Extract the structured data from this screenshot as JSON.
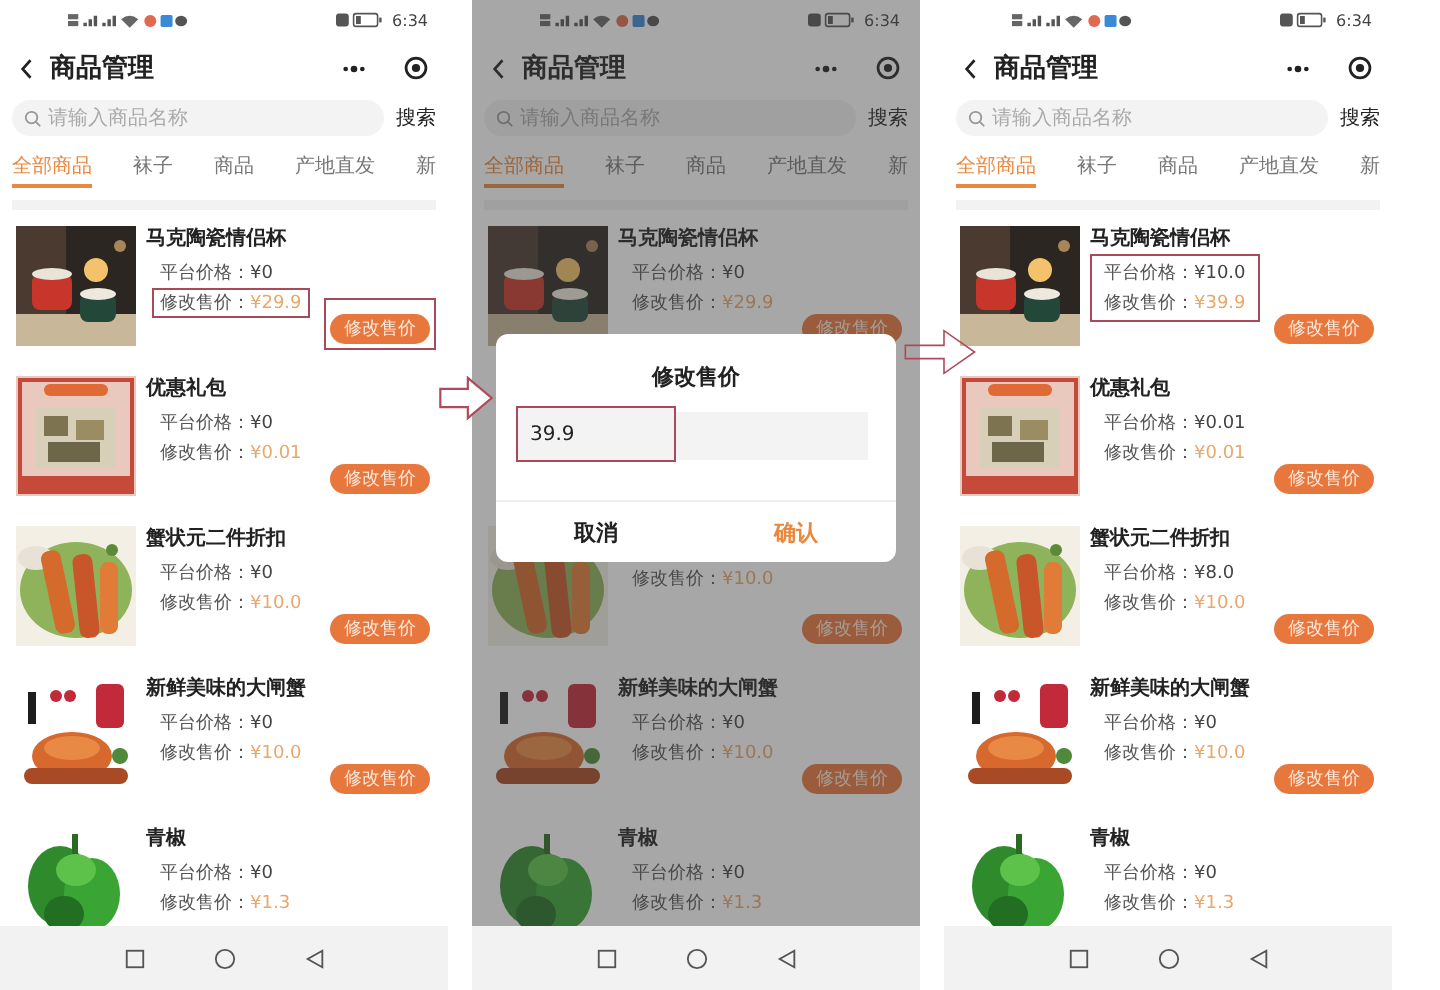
{
  "phones": [
    {
      "status_time": "6:34",
      "title": "商品管理",
      "search_placeholder": "请输入商品名称",
      "search_button": "搜索",
      "dimmed": false,
      "tabs": [
        {
          "label": "全部商品",
          "selected": true
        },
        {
          "label": "袜子",
          "selected": false
        },
        {
          "label": "商品",
          "selected": false
        },
        {
          "label": "产地直发",
          "selected": false
        },
        {
          "label": "新",
          "selected": false
        }
      ],
      "list": [
        {
          "kind": "product",
          "name": "马克陶瓷情侣杯",
          "platform_label": "平台价格：",
          "platform_price": "¥0",
          "modified_label": "修改售价：",
          "modified_price": "¥29.9",
          "modified_price_highlighted": true,
          "prices_highlighted": false,
          "button": "修改售价",
          "button_highlighted": true
        },
        {
          "kind": "product",
          "name": "优惠礼包",
          "platform_label": "平台价格：",
          "platform_price": "¥0",
          "modified_label": "修改售价：",
          "modified_price": "¥0.01",
          "modified_price_highlighted": false,
          "prices_highlighted": false,
          "button": "修改售价",
          "button_highlighted": false
        },
        {
          "kind": "product",
          "name": "蟹状元二件折扣",
          "platform_label": "平台价格：",
          "platform_price": "¥0",
          "modified_label": "修改售价：",
          "modified_price": "¥10.0",
          "modified_price_highlighted": false,
          "prices_highlighted": false,
          "button": "修改售价",
          "button_highlighted": false
        },
        {
          "kind": "product",
          "name": "新鲜美味的大闸蟹",
          "platform_label": "平台价格：",
          "platform_price": "¥0",
          "modified_label": "修改售价：",
          "modified_price": "¥10.0",
          "modified_price_highlighted": false,
          "prices_highlighted": false,
          "button": "修改售价",
          "button_highlighted": false
        },
        {
          "kind": "product",
          "name": "青椒",
          "platform_label": "平台价格：",
          "platform_price": "¥0",
          "modified_label": "修改售价：",
          "modified_price": "¥1.3",
          "modified_price_highlighted": false,
          "prices_highlighted": false
        }
      ]
    },
    {
      "status_time": "6:34",
      "title": "商品管理",
      "search_placeholder": "请输入商品名称",
      "search_button": "搜索",
      "dimmed": true,
      "tabs": [
        {
          "label": "全部商品",
          "selected": true
        },
        {
          "label": "袜子",
          "selected": false
        },
        {
          "label": "商品",
          "selected": false
        },
        {
          "label": "产地直发",
          "selected": false
        },
        {
          "label": "新",
          "selected": false
        }
      ],
      "list": [
        {
          "kind": "product",
          "name": "马克陶瓷情侣杯",
          "platform_label": "平台价格：",
          "platform_price": "¥0",
          "modified_label": "修改售价：",
          "modified_price": "¥29.9",
          "modified_price_highlighted": false,
          "prices_highlighted": false,
          "button": "修改售价",
          "button_highlighted": false
        },
        {
          "kind": "dialog",
          "title": "修改售价",
          "value": "39.9",
          "field_highlighted": true,
          "cancel": "取消",
          "confirm": "确认"
        },
        {
          "kind": "product",
          "modified_label": "修改售价：",
          "modified_price": "¥10.0",
          "modified_price_highlighted": false,
          "prices_highlighted": false,
          "button": "修改售价",
          "button_highlighted": false
        },
        {
          "kind": "product",
          "name": "新鲜美味的大闸蟹",
          "platform_label": "平台价格：",
          "platform_price": "¥0",
          "modified_label": "修改售价：",
          "modified_price": "¥10.0",
          "modified_price_highlighted": false,
          "prices_highlighted": false,
          "button": "修改售价",
          "button_highlighted": false
        },
        {
          "kind": "product",
          "name": "青椒",
          "platform_label": "平台价格：",
          "platform_price": "¥0",
          "modified_label": "修改售价：",
          "modified_price": "¥1.3",
          "modified_price_highlighted": false,
          "prices_highlighted": false
        }
      ]
    },
    {
      "status_time": "6:34",
      "title": "商品管理",
      "search_placeholder": "请输入商品名称",
      "search_button": "搜索",
      "dimmed": false,
      "tabs": [
        {
          "label": "全部商品",
          "selected": true
        },
        {
          "label": "袜子",
          "selected": false
        },
        {
          "label": "商品",
          "selected": false
        },
        {
          "label": "产地直发",
          "selected": false
        },
        {
          "label": "新",
          "selected": false
        }
      ],
      "list": [
        {
          "kind": "product",
          "name": "马克陶瓷情侣杯",
          "platform_label": "平台价格：",
          "platform_price": "¥10.0",
          "modified_label": "修改售价：",
          "modified_price": "¥39.9",
          "modified_price_highlighted": false,
          "prices_highlighted": true,
          "button": "修改售价",
          "button_highlighted": false
        },
        {
          "kind": "product",
          "name": "优惠礼包",
          "platform_label": "平台价格：",
          "platform_price": "¥0.01",
          "modified_label": "修改售价：",
          "modified_price": "¥0.01",
          "modified_price_highlighted": false,
          "prices_highlighted": false,
          "button": "修改售价",
          "button_highlighted": false
        },
        {
          "kind": "product",
          "name": "蟹状元二件折扣",
          "platform_label": "平台价格：",
          "platform_price": "¥8.0",
          "modified_label": "修改售价：",
          "modified_price": "¥10.0",
          "modified_price_highlighted": false,
          "prices_highlighted": false,
          "button": "修改售价",
          "button_highlighted": false
        },
        {
          "kind": "product",
          "name": "新鲜美味的大闸蟹",
          "platform_label": "平台价格：",
          "platform_price": "¥0",
          "modified_label": "修改售价：",
          "modified_price": "¥10.0",
          "modified_price_highlighted": false,
          "prices_highlighted": false,
          "button": "修改售价",
          "button_highlighted": false
        },
        {
          "kind": "product",
          "name": "青椒",
          "platform_label": "平台价格：",
          "platform_price": "¥0",
          "modified_label": "修改售价：",
          "modified_price": "¥1.3",
          "modified_price_highlighted": false,
          "prices_highlighted": false
        }
      ]
    }
  ]
}
